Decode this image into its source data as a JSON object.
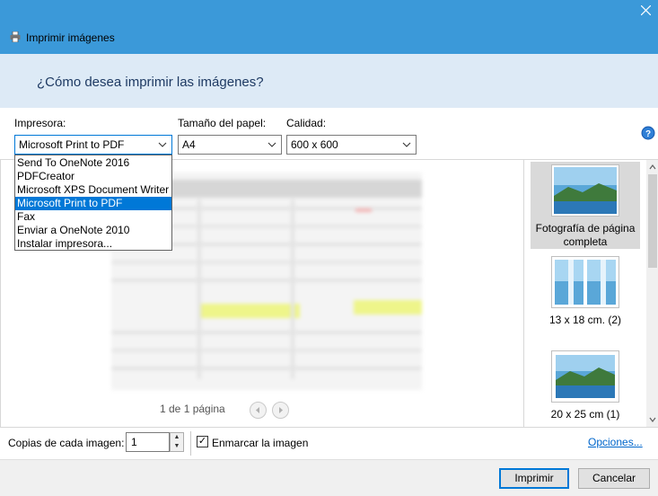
{
  "window": {
    "title": "Imprimir imágenes",
    "heading": "¿Cómo desea imprimir las imágenes?"
  },
  "settings": {
    "printer_label": "Impresora:",
    "printer_value": "Microsoft Print to PDF",
    "paper_label": "Tamaño del papel:",
    "paper_value": "A4",
    "quality_label": "Calidad:",
    "quality_value": "600 x 600"
  },
  "printer_options": [
    "Send To OneNote 2016",
    "PDFCreator",
    "Microsoft XPS Document Writer",
    "Microsoft Print to PDF",
    "Fax",
    "Enviar a OneNote 2010",
    "Instalar impresora..."
  ],
  "printer_selected_index": 3,
  "preview": {
    "page_info": "1 de 1 página"
  },
  "layouts": [
    {
      "label": "Fotografía de página completa",
      "selected": true
    },
    {
      "label": "13 x 18 cm. (2)",
      "selected": false
    },
    {
      "label": "20 x 25 cm (1)",
      "selected": false
    }
  ],
  "bottom": {
    "copies_label": "Copias de cada imagen:",
    "copies_value": "1",
    "frame_label": "Enmarcar la imagen",
    "frame_checked": true,
    "options_link": "Opciones..."
  },
  "buttons": {
    "print": "Imprimir",
    "cancel": "Cancelar"
  },
  "colors": {
    "titlebar": "#3b99d9",
    "header": "#ddeaf6",
    "selection": "#0078d7"
  }
}
